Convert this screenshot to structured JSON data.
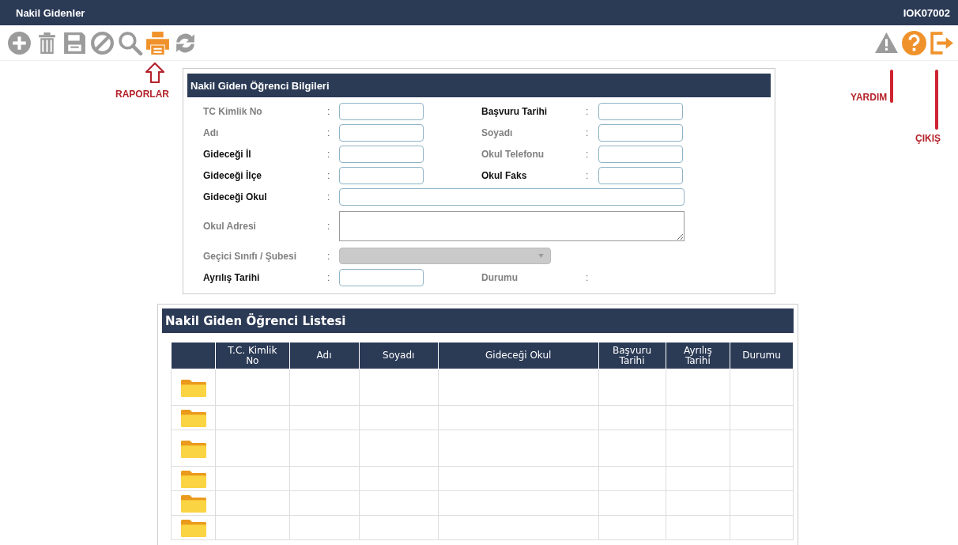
{
  "window": {
    "title": "Nakil Gidenler",
    "code": "IOK07002"
  },
  "toolbar": {
    "left": [
      {
        "kind": "add",
        "enabled": false
      },
      {
        "kind": "delete",
        "enabled": false
      },
      {
        "kind": "save",
        "enabled": false
      },
      {
        "kind": "cancel",
        "enabled": false
      },
      {
        "kind": "search",
        "enabled": false
      },
      {
        "kind": "print",
        "enabled": true
      },
      {
        "kind": "refresh",
        "enabled": false
      }
    ],
    "right": [
      {
        "kind": "warning",
        "enabled": false
      },
      {
        "kind": "help",
        "enabled": true
      },
      {
        "kind": "exit",
        "enabled": true
      }
    ]
  },
  "annotations": [
    {
      "kind": "raporlar",
      "text": "RAPORLAR"
    },
    {
      "kind": "yardim",
      "text": "YARDIM"
    },
    {
      "kind": "cikis",
      "text": "ÇIKIŞ"
    }
  ],
  "form": {
    "title": "Nakil Giden Öğrenci Bilgileri",
    "rows": [
      {
        "fields": [
          {
            "label": "TC Kimlik No",
            "colon": ":",
            "required": false,
            "kind": "input"
          },
          {
            "label": "Başvuru Tarihi",
            "colon": ":",
            "required": true,
            "kind": "input"
          }
        ]
      },
      {
        "fields": [
          {
            "label": "Adı",
            "colon": ":",
            "required": false,
            "kind": "input"
          },
          {
            "label": "Soyadı",
            "colon": ":",
            "required": false,
            "kind": "input"
          }
        ]
      },
      {
        "fields": [
          {
            "label": "Gideceği İl",
            "colon": ":",
            "required": true,
            "kind": "input"
          },
          {
            "label": "Okul Telefonu",
            "colon": ":",
            "required": false,
            "kind": "input"
          }
        ]
      },
      {
        "fields": [
          {
            "label": "Gideceği İlçe",
            "colon": ":",
            "required": true,
            "kind": "input"
          },
          {
            "label": "Okul Faks",
            "colon": ":",
            "required": true,
            "kind": "input"
          }
        ]
      },
      {
        "fields": [
          {
            "label": "Gideceği Okul",
            "colon": ":",
            "required": true,
            "kind": "wide"
          }
        ]
      },
      {
        "fields": [
          {
            "label": "Okul Adresi",
            "colon": ":",
            "required": false,
            "kind": "textarea"
          }
        ]
      },
      {
        "fields": [
          {
            "label": "Geçici Sınıfı / Şubesi",
            "colon": ":",
            "required": false,
            "kind": "select",
            "disabled": true
          }
        ]
      },
      {
        "fields": [
          {
            "label": "Ayrılış Tarihi",
            "colon": ":",
            "required": true,
            "kind": "input"
          },
          {
            "label": "Durumu",
            "colon": ":",
            "required": false,
            "kind": "none"
          }
        ]
      }
    ]
  },
  "list": {
    "title": "Nakil Giden Öğrenci Listesi",
    "columns": [
      "T.C. Kimlik No",
      "Adı",
      "Soyadı",
      "Gideceği Okul",
      "Başvuru Tarihi",
      "Ayrılış Tarihi",
      "Durumu"
    ],
    "rows": [
      {
        "tall": true
      },
      {
        "tall": false
      },
      {
        "tall": true
      },
      {
        "tall": false
      },
      {
        "tall": false
      },
      {
        "tall": false
      }
    ]
  }
}
